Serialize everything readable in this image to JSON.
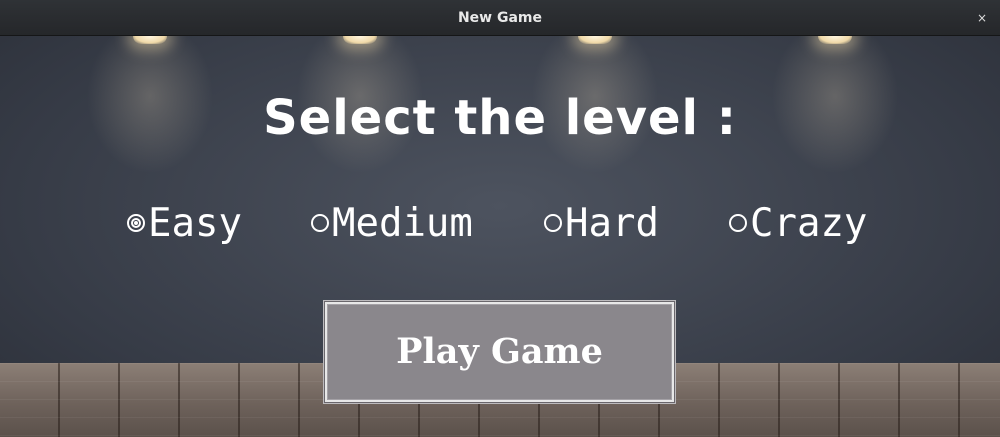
{
  "window": {
    "title": "New Game",
    "close_label": "×"
  },
  "main": {
    "heading": "Select the level :",
    "levels": [
      {
        "label": "Easy",
        "selected": true
      },
      {
        "label": "Medium",
        "selected": false
      },
      {
        "label": "Hard",
        "selected": false
      },
      {
        "label": "Crazy",
        "selected": false
      }
    ],
    "play_button_label": "Play Game"
  },
  "colors": {
    "button_bg": "#8a878c",
    "text": "#ffffff",
    "titlebar": "#2b2d30"
  }
}
